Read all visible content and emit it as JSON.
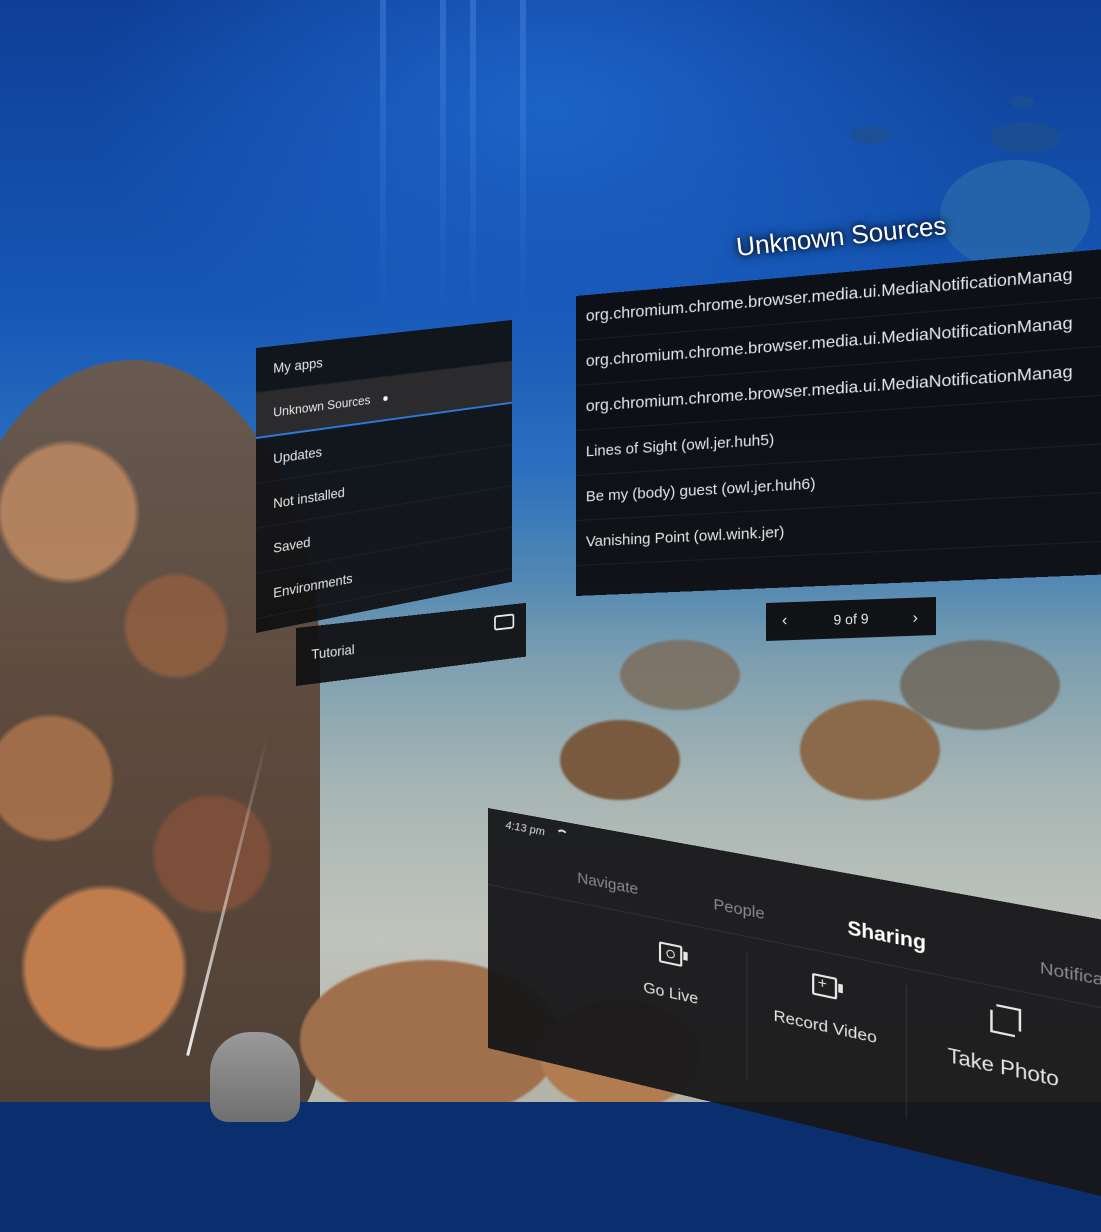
{
  "library": {
    "title": "Unknown Sources",
    "sidebar": {
      "items": [
        {
          "label": "My apps"
        },
        {
          "label": "Unknown Sources"
        },
        {
          "label": "Updates"
        },
        {
          "label": "Not installed"
        },
        {
          "label": "Saved"
        },
        {
          "label": "Environments"
        }
      ],
      "tutorial_label": "Tutorial"
    },
    "list": {
      "items": [
        "org.chromium.chrome.browser.media.ui.MediaNotificationManag",
        "org.chromium.chrome.browser.media.ui.MediaNotificationManag",
        "org.chromium.chrome.browser.media.ui.MediaNotificationManag",
        "Lines of Sight (owl.jer.huh5)",
        "Be my (body) guest (owl.jer.huh6)",
        "Vanishing Point (owl.wink.jer)"
      ]
    },
    "pager": {
      "label": "9 of 9",
      "prev_glyph": "‹",
      "next_glyph": "›"
    }
  },
  "dock": {
    "time": "4:13 pm",
    "tabs": [
      "Navigate",
      "People",
      "Sharing",
      "Notifications"
    ],
    "actions": [
      "Go Live",
      "Record Video",
      "Take Photo"
    ]
  },
  "icons": {
    "wifi": "wifi-icon",
    "controller": "controller-icon",
    "go_live": "go-live-icon",
    "record": "record-video-icon",
    "photo": "crop-photo-icon"
  },
  "colors": {
    "accent": "#2a7bd9",
    "panel": "#101012"
  }
}
